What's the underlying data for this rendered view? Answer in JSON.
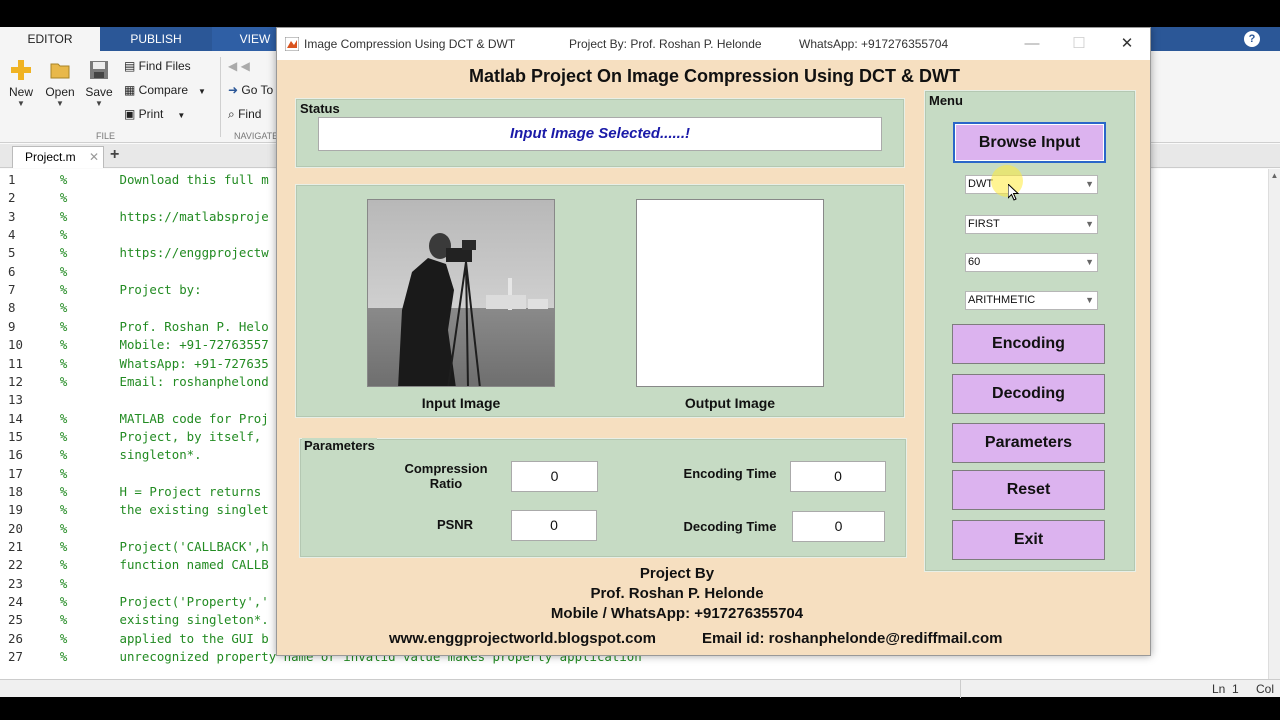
{
  "ribbon": {
    "tabs": [
      "EDITOR",
      "PUBLISH",
      "VIEW"
    ],
    "file_group": {
      "new": "New",
      "open": "Open",
      "save": "Save",
      "find_files": "Find Files",
      "compare": "Compare",
      "print": "Print",
      "label": "FILE"
    },
    "navigate_group": {
      "go_to": "Go To",
      "find": "Find",
      "label": "NAVIGATE"
    }
  },
  "editor": {
    "file_tab": "Project.m",
    "lines": [
      {
        "n": "1",
        "text": "    %       Download this full m"
      },
      {
        "n": "2",
        "text": "    %"
      },
      {
        "n": "3",
        "text": "    %       https://matlabsproje"
      },
      {
        "n": "4",
        "text": "    %"
      },
      {
        "n": "5",
        "text": "    %       https://enggprojectw"
      },
      {
        "n": "6",
        "text": "    %"
      },
      {
        "n": "7",
        "text": "    %       Project by:"
      },
      {
        "n": "8",
        "text": "    %"
      },
      {
        "n": "9",
        "text": "    %       Prof. Roshan P. Helo"
      },
      {
        "n": "10",
        "text": "    %       Mobile: +91-72763557"
      },
      {
        "n": "11",
        "text": "    %       WhatsApp: +91-727635"
      },
      {
        "n": "12",
        "text": "    %       Email: roshanphelond"
      },
      {
        "n": "13",
        "text": ""
      },
      {
        "n": "14",
        "text": "    %       MATLAB code for Proj"
      },
      {
        "n": "15",
        "text": "    %       Project, by itself,"
      },
      {
        "n": "16",
        "text": "    %       singleton*."
      },
      {
        "n": "17",
        "text": "    %"
      },
      {
        "n": "18",
        "text": "    %       H = Project returns"
      },
      {
        "n": "19",
        "text": "    %       the existing singlet"
      },
      {
        "n": "20",
        "text": "    %"
      },
      {
        "n": "21",
        "text": "    %       Project('CALLBACK',h"
      },
      {
        "n": "22",
        "text": "    %       function named CALLB"
      },
      {
        "n": "23",
        "text": "    %"
      },
      {
        "n": "24",
        "text": "    %       Project('Property','"
      },
      {
        "n": "25",
        "text": "    %       existing singleton*."
      },
      {
        "n": "26",
        "text": "    %       applied to the GUI b"
      },
      {
        "n": "27",
        "text": "    %       unrecognized property name or invalid value makes property application"
      }
    ],
    "status": {
      "ln_label": "Ln",
      "ln_value": "1",
      "col_label": "Col"
    }
  },
  "figure": {
    "window_title": "Image Compression Using DCT & DWT",
    "project_by": "Project By: Prof. Roshan P. Helonde",
    "whatsapp": "WhatsApp: +917276355704",
    "heading": "Matlab Project On Image Compression Using DCT & DWT",
    "status_panel": {
      "title": "Status",
      "message": "Input Image Selected......!"
    },
    "images": {
      "input_label": "Input Image",
      "output_label": "Output Image"
    },
    "parameters": {
      "title": "Parameters",
      "compression_ratio_label": "Compression Ratio",
      "compression_ratio": "0",
      "psnr_label": "PSNR",
      "psnr": "0",
      "encoding_time_label": "Encoding Time",
      "encoding_time": "0",
      "decoding_time_label": "Decoding Time",
      "decoding_time": "0"
    },
    "menu": {
      "title": "Menu",
      "browse": "Browse Input",
      "transform": "DWT",
      "level": "FIRST",
      "quality": "60",
      "coding": "ARITHMETIC",
      "encoding": "Encoding",
      "decoding": "Decoding",
      "parameters": "Parameters",
      "reset": "Reset",
      "exit": "Exit"
    },
    "credits": {
      "line1": "Project By",
      "line2": "Prof. Roshan P. Helonde",
      "line3": "Mobile / WhatsApp: +917276355704",
      "website": "www.enggprojectworld.blogspot.com",
      "email": "Email id: roshanphelonde@rediffmail.com"
    }
  },
  "colors": {
    "figure_bg": "#f6dfc0",
    "panel_bg": "#c6dbc4",
    "button_bg": "#dcb3ef",
    "status_text": "#1a1aa8",
    "ribbon_blue": "#2b5797"
  }
}
